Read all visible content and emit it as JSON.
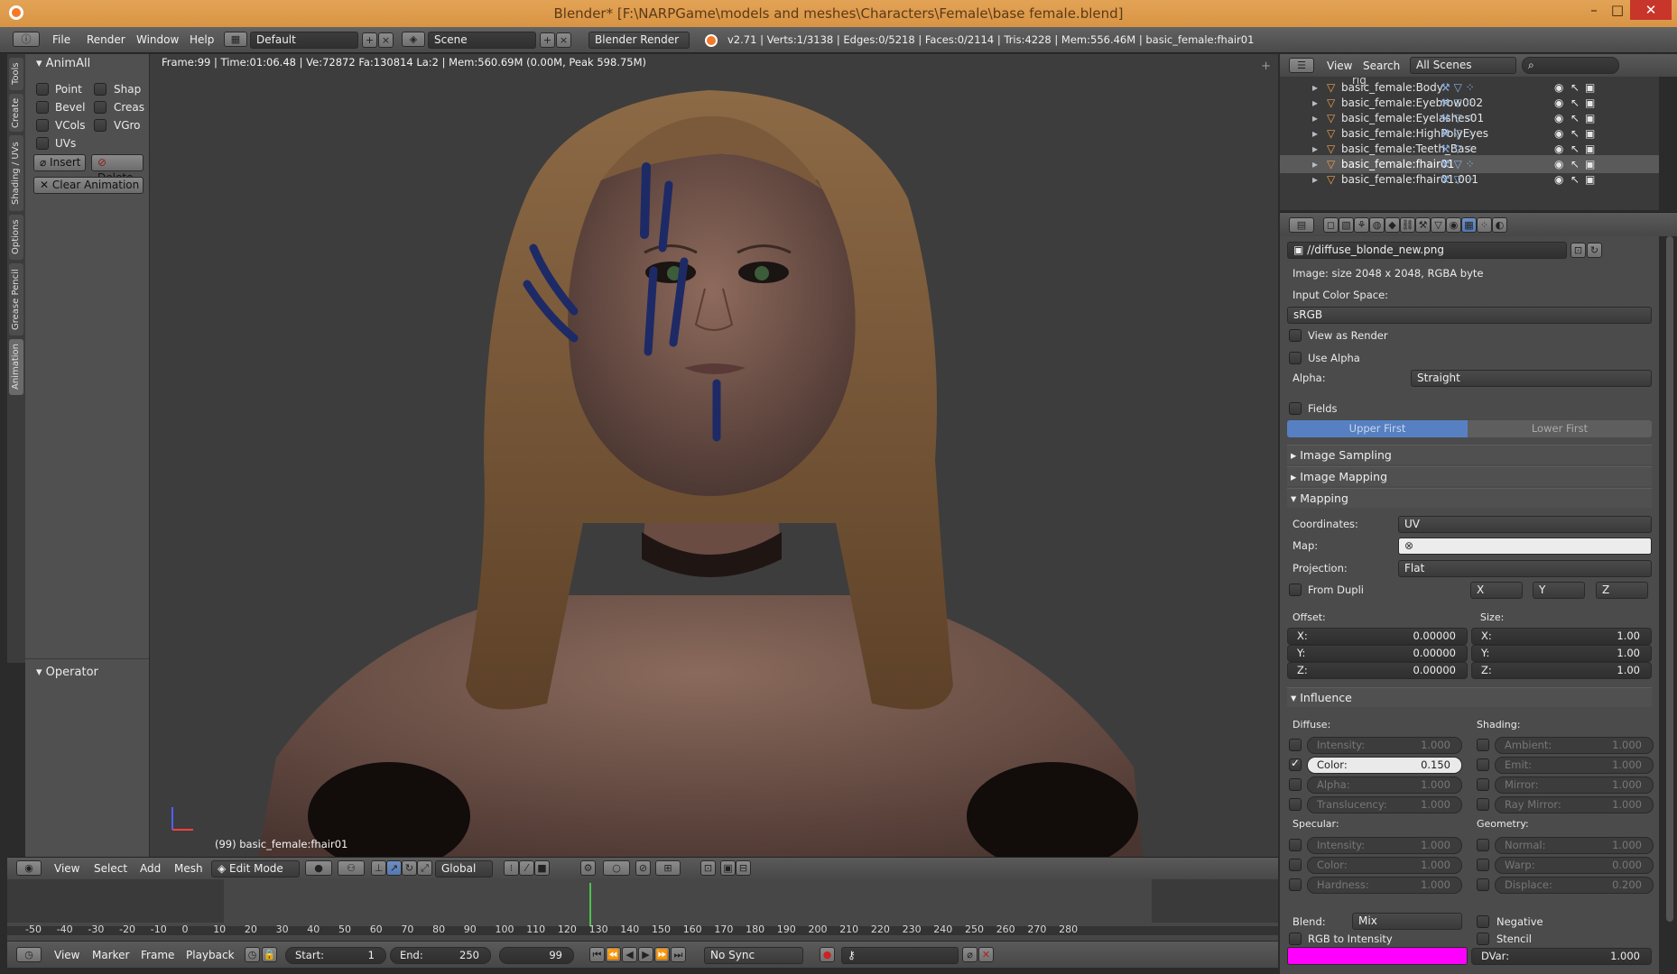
{
  "titlebar": {
    "title": "Blender* [F:\\NARPGame\\models and meshes\\Characters\\Female\\base female.blend]",
    "minimize": "–",
    "maximize": "□",
    "close": "✕"
  },
  "info_header": {
    "menus": [
      "File",
      "Render",
      "Window",
      "Help"
    ],
    "layout": "Default",
    "scene": "Scene",
    "engine": "Blender Render",
    "stats": "v2.71 | Verts:1/3138 | Edges:0/5218 | Faces:0/2114 | Tris:4228 | Mem:556.46M | basic_female:fhair01"
  },
  "left_tabs": [
    "Tools",
    "Create",
    "Shading / UVs",
    "Options",
    "Grease Pencil",
    "Animation"
  ],
  "toolshelf": {
    "panel_title": "AnimAll",
    "checks": [
      {
        "label": "Point",
        "on": false
      },
      {
        "label": "Shap",
        "on": false
      },
      {
        "label": "Bevel",
        "on": false
      },
      {
        "label": "Creas",
        "on": false
      },
      {
        "label": "VCols",
        "on": false
      },
      {
        "label": "VGro",
        "on": false
      },
      {
        "label": "UVs",
        "on": false
      }
    ],
    "insert": "Insert",
    "delete": "Delete",
    "clear_animation": "Clear Animation",
    "operator_title": "Operator"
  },
  "viewport": {
    "info": "Frame:99 | Time:01:06.48 | Ve:72872 Fa:130814 La:2 | Mem:560.69M (0.00M, Peak 598.75M)",
    "object_label": "(99) basic_female:fhair01"
  },
  "viewport_header": {
    "menus": [
      "View",
      "Select",
      "Add",
      "Mesh"
    ],
    "mode": "Edit Mode",
    "orientation": "Global"
  },
  "timeline": {
    "ticks": [
      "-50",
      "-40",
      "-30",
      "-20",
      "-10",
      "0",
      "10",
      "20",
      "30",
      "40",
      "50",
      "60",
      "70",
      "80",
      "90",
      "100",
      "110",
      "120",
      "130",
      "140",
      "150",
      "160",
      "170",
      "180",
      "190",
      "200",
      "210",
      "220",
      "230",
      "240",
      "250",
      "260",
      "270",
      "280"
    ],
    "current_frame": 99
  },
  "timeline_footer": {
    "menus": [
      "View",
      "Marker",
      "Frame",
      "Playback"
    ],
    "start_label": "Start:",
    "start": "1",
    "end_label": "End:",
    "end": "250",
    "frame": "99",
    "sync": "No Sync"
  },
  "outliner": {
    "menus": [
      "View",
      "Search"
    ],
    "filter": "All Scenes",
    "partial_row": "rig",
    "rows": [
      "basic_female:Body",
      "basic_female:Eyebrow002",
      "basic_female:Eyelashes01",
      "basic_female:HighPolyEyes",
      "basic_female:Teeth_Base",
      "basic_female:fhair01",
      "basic_female:fhair01.001"
    ],
    "selected": "basic_female:fhair01"
  },
  "properties": {
    "image_path": "//diffuse_blonde_new.png",
    "image_info": "Image: size 2048 x 2048, RGBA byte",
    "input_color_space_label": "Input Color Space:",
    "color_space": "sRGB",
    "view_as_render": "View as Render",
    "use_alpha": "Use Alpha",
    "alpha_label": "Alpha:",
    "alpha_value": "Straight",
    "fields": "Fields",
    "upper_first": "Upper First",
    "lower_first": "Lower First",
    "image_sampling": "Image Sampling",
    "image_mapping": "Image Mapping",
    "mapping": "Mapping",
    "coordinates_label": "Coordinates:",
    "coordinates": "UV",
    "map_label": "Map:",
    "projection_label": "Projection:",
    "projection": "Flat",
    "from_dupli": "From Dupli",
    "axes": [
      "X",
      "Y",
      "Z"
    ],
    "offset_label": "Offset:",
    "size_label": "Size:",
    "offset": [
      {
        "n": "X:",
        "v": "0.00000"
      },
      {
        "n": "Y:",
        "v": "0.00000"
      },
      {
        "n": "Z:",
        "v": "0.00000"
      }
    ],
    "size": [
      {
        "n": "X:",
        "v": "1.00"
      },
      {
        "n": "Y:",
        "v": "1.00"
      },
      {
        "n": "Z:",
        "v": "1.00"
      }
    ],
    "influence": "Influence",
    "diffuse_label": "Diffuse:",
    "shading_label": "Shading:",
    "specular_label": "Specular:",
    "geometry_label": "Geometry:",
    "diffuse": [
      {
        "n": "Intensity:",
        "v": "1.000",
        "on": false
      },
      {
        "n": "Color:",
        "v": "0.150",
        "on": true
      },
      {
        "n": "Alpha:",
        "v": "1.000",
        "on": false
      },
      {
        "n": "Translucency:",
        "v": "1.000",
        "on": false
      }
    ],
    "shading": [
      {
        "n": "Ambient:",
        "v": "1.000"
      },
      {
        "n": "Emit:",
        "v": "1.000"
      },
      {
        "n": "Mirror:",
        "v": "1.000"
      },
      {
        "n": "Ray Mirror:",
        "v": "1.000"
      }
    ],
    "specular": [
      {
        "n": "Intensity:",
        "v": "1.000"
      },
      {
        "n": "Color:",
        "v": "1.000"
      },
      {
        "n": "Hardness:",
        "v": "1.000"
      }
    ],
    "geometry": [
      {
        "n": "Normal:",
        "v": "1.000"
      },
      {
        "n": "Warp:",
        "v": "0.000"
      },
      {
        "n": "Displace:",
        "v": "0.200"
      }
    ],
    "blend_label": "Blend:",
    "blend": "Mix",
    "negative": "Negative",
    "rgb_to_intensity": "RGB to Intensity",
    "stencil": "Stencil",
    "dvar_label": "DVar:",
    "dvar": "1.000",
    "color_swatch": "#ff00ff"
  }
}
